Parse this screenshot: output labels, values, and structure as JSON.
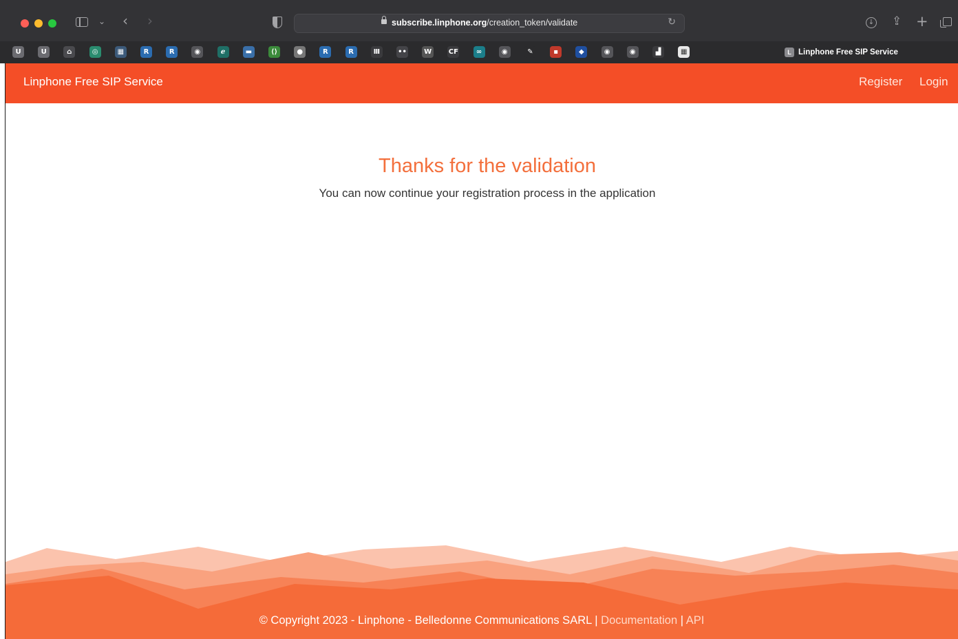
{
  "browser": {
    "url_domain": "subscribe.linphone.org",
    "url_path": "/creation_token/validate",
    "tab_title": "Linphone Free SIP Service",
    "tab_badge": "L",
    "favorites": [
      {
        "icon": "u-icon",
        "label": "U",
        "color": "#6b6b70"
      },
      {
        "icon": "u-icon",
        "label": "U",
        "color": "#6b6b70"
      },
      {
        "icon": "home-icon",
        "label": "⌂",
        "color": "#4a4a4e"
      },
      {
        "icon": "openai-icon",
        "label": "◎",
        "color": "#2a8c6f"
      },
      {
        "icon": "grid-icon",
        "label": "▦",
        "color": "#3c5a7a"
      },
      {
        "icon": "r-icon",
        "label": "R",
        "color": "#2b6cb0"
      },
      {
        "icon": "r-icon",
        "label": "R",
        "color": "#2b6cb0"
      },
      {
        "icon": "github-icon",
        "label": "◉",
        "color": "#555559"
      },
      {
        "icon": "e-icon",
        "label": "ℯ",
        "color": "#1f6f66"
      },
      {
        "icon": "dash-icon",
        "label": "▬",
        "color": "#3a6fa8"
      },
      {
        "icon": "code-icon",
        "label": "⟨⟩",
        "color": "#3b8a3b"
      },
      {
        "icon": "globe-icon",
        "label": "●",
        "color": "#777"
      },
      {
        "icon": "r-icon",
        "label": "R",
        "color": "#2b6cb0"
      },
      {
        "icon": "r-icon",
        "label": "R",
        "color": "#2b6cb0"
      },
      {
        "icon": "bars-icon",
        "label": "Ⅲ",
        "color": "#3a3a3d"
      },
      {
        "icon": "dots-icon",
        "label": "••",
        "color": "#444448"
      },
      {
        "icon": "w-icon",
        "label": "W",
        "color": "#555"
      },
      {
        "icon": "cf-icon",
        "label": "CF",
        "color": "#3a3a3d"
      },
      {
        "icon": "infinity-icon",
        "label": "∞",
        "color": "#1b7e8a"
      },
      {
        "icon": "github-icon",
        "label": "◉",
        "color": "#555559"
      },
      {
        "icon": "pen-icon",
        "label": "✎",
        "color": "#2b2b2d"
      },
      {
        "icon": "pdf-icon",
        "label": "▪",
        "color": "#c0392b"
      },
      {
        "icon": "bookmark-icon",
        "label": "◆",
        "color": "#1f4fa0"
      },
      {
        "icon": "github-icon",
        "label": "◉",
        "color": "#555559"
      },
      {
        "icon": "github-icon",
        "label": "◉",
        "color": "#555559"
      },
      {
        "icon": "chart-icon",
        "label": "▟",
        "color": "#3a3a3d"
      },
      {
        "icon": "calendar-icon",
        "label": "▦",
        "color": "#e8e8e8"
      }
    ]
  },
  "site": {
    "brand": "Linphone Free SIP Service",
    "nav_register": "Register",
    "nav_login": "Login",
    "accent_color": "#f44e27"
  },
  "main": {
    "heading": "Thanks for the validation",
    "subtext": "You can now continue your registration process in the application"
  },
  "footer": {
    "copyright": "© Copyright 2023 - Linphone - Belledonne Communications SARL",
    "separator": " | ",
    "documentation_link": "Documentation",
    "api_link": "API"
  }
}
